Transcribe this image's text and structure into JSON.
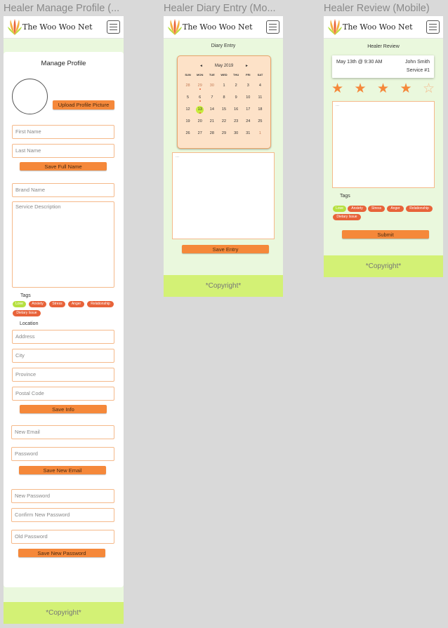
{
  "frames": [
    {
      "title": "Healer Manage Profile (..."
    },
    {
      "title": "Healer Diary Entry (Mo..."
    },
    {
      "title": "Healer Review (Mobile)"
    }
  ],
  "brand": "The Woo Woo Net",
  "footer": "*Copyright*",
  "profile": {
    "title": "Manage Profile",
    "upload_label": "Upload Profile Picture",
    "first_name_ph": "First Name",
    "last_name_ph": "Last Name",
    "save_full_name": "Save Full Name",
    "brand_name_ph": "Brand Name",
    "service_desc_ph": "Service Description",
    "tags_label": "Tags",
    "tags": [
      "Love",
      "Anxiety",
      "Stress",
      "Anger",
      "Relationship",
      "Dietary Issue"
    ],
    "location_label": "Location",
    "address_ph": "Address",
    "city_ph": "City",
    "province_ph": "Province",
    "postal_ph": "Postal Code",
    "save_info": "Save Info",
    "new_email_ph": "New Email",
    "password_ph": "Password",
    "save_email": "Save New Email",
    "new_password_ph": "New Password",
    "confirm_password_ph": "Confirm New Password",
    "old_password_ph": "Old Password",
    "save_password": "Save New Password"
  },
  "diary": {
    "title": "Diary Entry",
    "month": "May 2019",
    "prev": "◄",
    "next": "►",
    "weekdays": [
      "SUN",
      "MON",
      "TUE",
      "WED",
      "THU",
      "FRI",
      "SAT"
    ],
    "days": [
      "28",
      "29",
      "30",
      "1",
      "2",
      "3",
      "4",
      "5",
      "6",
      "7",
      "8",
      "9",
      "10",
      "11",
      "12",
      "13",
      "14",
      "15",
      "16",
      "17",
      "18",
      "19",
      "20",
      "21",
      "22",
      "23",
      "24",
      "25",
      "26",
      "27",
      "28",
      "29",
      "30",
      "31",
      "1"
    ],
    "other_month_days": [
      0,
      1,
      2,
      34
    ],
    "dotted_days": [
      1,
      8,
      15
    ],
    "today_index": 15,
    "entry_placeholder": "...",
    "save_label": "Save Entry"
  },
  "review": {
    "title": "Healer Review",
    "date": "May 13th @ 9:30 AM",
    "client": "John Smith",
    "service": "Service #1",
    "rating": 4,
    "max_rating": 5,
    "text_placeholder": "...",
    "tags_label": "Tags",
    "tags": [
      "Love",
      "Anxiety",
      "Stress",
      "Anger",
      "Relationship",
      "Dietary Issue"
    ],
    "submit_label": "Submit"
  },
  "colors": {
    "accent": "#f5883a",
    "tag": "#e8633a",
    "love_tag": "#b6e040",
    "page_bg": "#eaf8dd",
    "footer_bg": "#d3f175",
    "calendar_bg": "#fde2c8"
  }
}
